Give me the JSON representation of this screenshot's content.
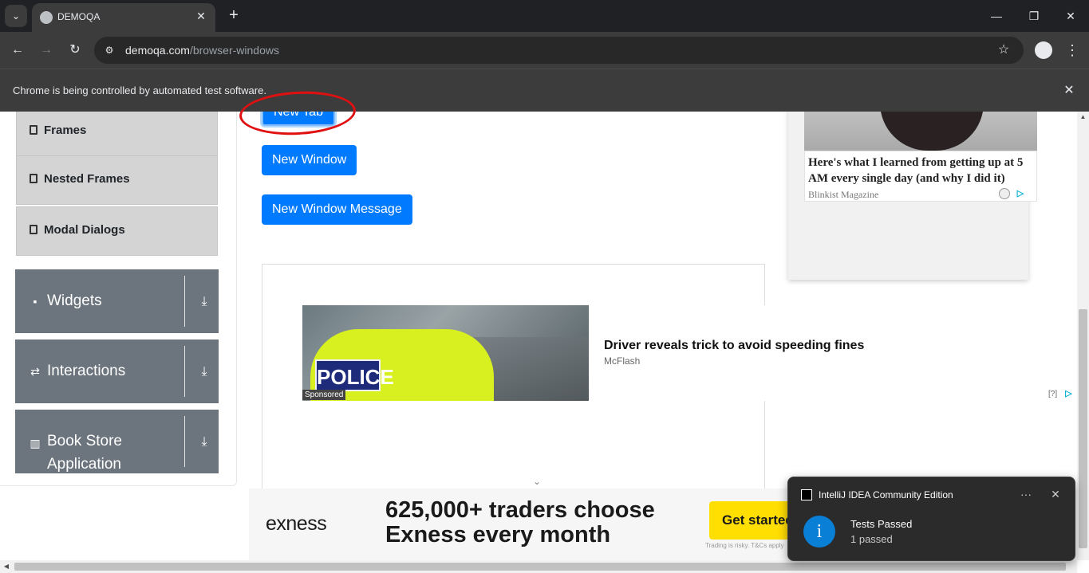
{
  "browser": {
    "tab_search_glyph": "⌄",
    "tab_title": "DEMOQA",
    "tab_close_glyph": "✕",
    "new_tab_glyph": "+",
    "window_minimize_glyph": "—",
    "window_restore_glyph": "❐",
    "window_close_glyph": "✕",
    "back_glyph": "←",
    "forward_glyph": "→",
    "reload_glyph": "↻",
    "site_info_glyph": "⚙",
    "url_domain": "demoqa.com",
    "url_path": "/browser-windows",
    "bookmark_glyph": "☆",
    "menu_glyph": "⋮",
    "infobar_text": "Chrome is being controlled by automated test software.",
    "infobar_close_glyph": "✕"
  },
  "sidebar": {
    "sub_items": [
      {
        "label": "Frames"
      },
      {
        "label": "Nested Frames"
      },
      {
        "label": "Modal Dialogs"
      }
    ],
    "groups": [
      {
        "label": "Widgets",
        "icon": "widgets-icon",
        "glyph": "▪"
      },
      {
        "label": "Interactions",
        "icon": "interactions-icon",
        "glyph": "⇄"
      },
      {
        "label_line1": "Book Store",
        "label_line2": "Application",
        "icon": "book-icon",
        "glyph": "▥"
      }
    ],
    "download_glyph": "⤓"
  },
  "main": {
    "buttons": {
      "new_tab": "New Tab",
      "new_window": "New Window",
      "new_window_message": "New Window Message"
    }
  },
  "ads": {
    "police_text": "POLICE",
    "sponsored_label": "Sponsored",
    "headline": "Driver reveals trick to avoid speeding fines",
    "source": "McFlash",
    "adchoice_q": "[?]",
    "adchoice_glyph": "▷",
    "chevron_glyph": "⌄",
    "side_title": "Here's what I learned from getting up at 5 AM every single day (and why I did it)",
    "side_source": "Blinkist Magazine",
    "side_choice_glyph": "▷",
    "exness_logo": "exness",
    "exness_headline_line1": "625,000+ traders choose",
    "exness_headline_line2": "Exness every month",
    "exness_cta": "Get started",
    "exness_risk": "Trading is risky. T&Cs apply"
  },
  "scroll": {
    "up_glyph": "▲",
    "left_glyph": "◀"
  },
  "toast": {
    "app_name": "IntelliJ IDEA Community Edition",
    "more_glyph": "···",
    "close_glyph": "✕",
    "info_glyph": "i",
    "title": "Tests Passed",
    "body": "1 passed"
  },
  "colors": {
    "primary_button": "#007bff",
    "sidebar_group": "#6c757d",
    "annotation": "#e01010",
    "exness_cta": "#ffde02"
  }
}
